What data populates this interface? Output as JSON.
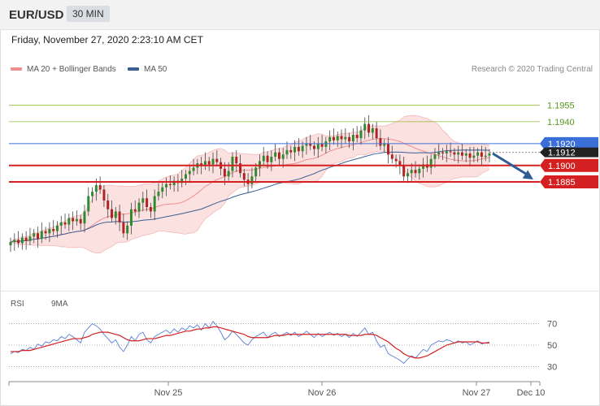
{
  "header": {
    "symbol": "EUR/USD",
    "timeframe": "30 MIN"
  },
  "datetime": "Friday, November 27, 2020 2:23:10 AM CET",
  "legend": {
    "ma20": {
      "label": "MA 20 + Bollinger Bands",
      "color": "#ef8f8f"
    },
    "ma50": {
      "label": "MA 50",
      "color": "#3a5f95"
    }
  },
  "credit": "Research © 2020 Trading Central",
  "rsi_legend": {
    "rsi": {
      "label": "RSI",
      "color": "#5b7fd6"
    },
    "ma9": {
      "label": "9MA",
      "color": "#d42020"
    }
  },
  "colors": {
    "up": "#2f8a2f",
    "down": "#b22222",
    "support": "#d42020",
    "resistance": "#8fba3a",
    "pivot": "#3b6fd8",
    "current": "#222222",
    "arrow": "#2f5c95"
  },
  "chart_data": [
    {
      "type": "candlestick",
      "title": "EUR/USD 30 MIN",
      "ylim": [
        1.179,
        1.198
      ],
      "x_ticks": [
        "Nov 25",
        "Nov 26",
        "Nov 27",
        "Dec 10"
      ],
      "price_levels": [
        {
          "value": 1.1955,
          "label": "1.1955",
          "kind": "resistance"
        },
        {
          "value": 1.194,
          "label": "1.1940",
          "kind": "resistance"
        },
        {
          "value": 1.192,
          "label": "1.1920",
          "kind": "pivot"
        },
        {
          "value": 1.1912,
          "label": "1.1912",
          "kind": "current"
        },
        {
          "value": 1.19,
          "label": "1.1900",
          "kind": "support"
        },
        {
          "value": 1.1885,
          "label": "1.1885",
          "kind": "support"
        }
      ],
      "close": [
        1.183,
        1.1832,
        1.1829,
        1.1834,
        1.1831,
        1.1835,
        1.1838,
        1.1833,
        1.184,
        1.1838,
        1.1842,
        1.184,
        1.1845,
        1.1848,
        1.1846,
        1.1852,
        1.1849,
        1.1851,
        1.1847,
        1.1858,
        1.1872,
        1.1876,
        1.1882,
        1.1878,
        1.1868,
        1.186,
        1.1852,
        1.1858,
        1.1848,
        1.1838,
        1.1845,
        1.186,
        1.1858,
        1.1866,
        1.187,
        1.1862,
        1.1858,
        1.1872,
        1.1876,
        1.188,
        1.1883,
        1.1882,
        1.1886,
        1.1884,
        1.1888,
        1.1892,
        1.1895,
        1.1898,
        1.1902,
        1.19,
        1.1904,
        1.1901,
        1.1906,
        1.1903,
        1.1897,
        1.189,
        1.1895,
        1.1908,
        1.1902,
        1.1893,
        1.1887,
        1.1883,
        1.189,
        1.1898,
        1.1904,
        1.1909,
        1.1903,
        1.1908,
        1.1912,
        1.1906,
        1.191,
        1.1914,
        1.1912,
        1.1917,
        1.1913,
        1.1918,
        1.192,
        1.1918,
        1.1915,
        1.192,
        1.1917,
        1.1922,
        1.1926,
        1.1923,
        1.1927,
        1.1924,
        1.1926,
        1.1922,
        1.1928,
        1.1925,
        1.1932,
        1.1938,
        1.193,
        1.1934,
        1.1925,
        1.1918,
        1.192,
        1.191,
        1.1906,
        1.1904,
        1.19,
        1.189,
        1.1893,
        1.1896,
        1.1893,
        1.1897,
        1.1901,
        1.1898,
        1.1906,
        1.191,
        1.1912,
        1.1911,
        1.1913,
        1.1912,
        1.191,
        1.1912,
        1.1909,
        1.1911,
        1.1907,
        1.1909,
        1.1912,
        1.1908,
        1.1909,
        1.1911
      ]
    },
    {
      "type": "line",
      "title": "RSI",
      "ylim": [
        22,
        78
      ],
      "y_ticks": [
        30,
        50,
        70
      ],
      "series": [
        {
          "name": "RSI",
          "values": [
            42,
            44,
            43,
            46,
            45,
            48,
            46,
            51,
            49,
            53,
            52,
            55,
            54,
            58,
            56,
            60,
            58,
            55,
            52,
            62,
            66,
            70,
            68,
            65,
            60,
            56,
            52,
            55,
            48,
            44,
            50,
            58,
            54,
            60,
            62,
            55,
            52,
            58,
            60,
            62,
            64,
            61,
            65,
            62,
            66,
            64,
            68,
            66,
            69,
            64,
            70,
            66,
            72,
            68,
            62,
            55,
            58,
            63,
            60,
            56,
            52,
            50,
            55,
            58,
            60,
            62,
            57,
            60,
            62,
            58,
            60,
            62,
            59,
            62,
            58,
            60,
            63,
            60,
            57,
            61,
            58,
            60,
            62,
            59,
            61,
            58,
            60,
            57,
            61,
            58,
            62,
            66,
            60,
            62,
            54,
            48,
            50,
            42,
            40,
            38,
            36,
            33,
            37,
            40,
            38,
            42,
            46,
            44,
            50,
            52,
            54,
            53,
            55,
            54,
            52,
            54,
            52,
            53,
            50,
            52,
            54,
            51,
            52,
            53
          ]
        },
        {
          "name": "9MA",
          "values": [
            44,
            44,
            44,
            45,
            45,
            45,
            46,
            47,
            48,
            49,
            50,
            51,
            52,
            53,
            54,
            55,
            56,
            56,
            56,
            57,
            58,
            60,
            61,
            62,
            62,
            62,
            61,
            60,
            59,
            57,
            55,
            54,
            54,
            54,
            55,
            56,
            56,
            56,
            57,
            58,
            59,
            59,
            60,
            61,
            62,
            63,
            63,
            64,
            65,
            65,
            66,
            66,
            67,
            67,
            66,
            65,
            64,
            63,
            62,
            61,
            60,
            58,
            57,
            57,
            57,
            57,
            57,
            58,
            59,
            59,
            59,
            60,
            60,
            60,
            60,
            60,
            60,
            60,
            60,
            60,
            60,
            60,
            60,
            60,
            60,
            60,
            60,
            59,
            59,
            59,
            59,
            60,
            60,
            60,
            59,
            57,
            55,
            53,
            50,
            47,
            45,
            42,
            40,
            39,
            38,
            38,
            39,
            40,
            42,
            44,
            46,
            48,
            50,
            51,
            52,
            53,
            53,
            53,
            53,
            53,
            53,
            52,
            52,
            52
          ]
        }
      ]
    }
  ]
}
